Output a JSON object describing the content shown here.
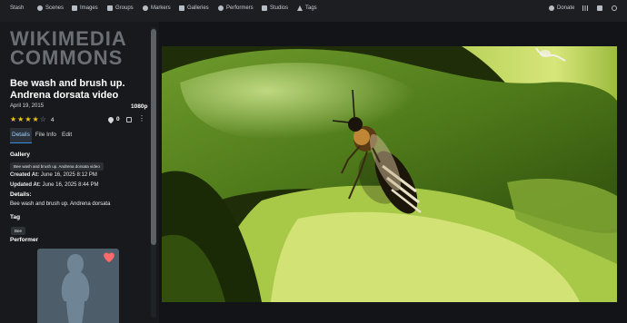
{
  "navbar": {
    "brand": "Stash",
    "items": [
      {
        "label": "Scenes",
        "icon": "play-circle-icon"
      },
      {
        "label": "Images",
        "icon": "image-icon"
      },
      {
        "label": "Groups",
        "icon": "film-icon"
      },
      {
        "label": "Markers",
        "icon": "location-marker-icon"
      },
      {
        "label": "Galleries",
        "icon": "gallery-icon"
      },
      {
        "label": "Performers",
        "icon": "user-icon"
      },
      {
        "label": "Studios",
        "icon": "video-camera-icon"
      },
      {
        "label": "Tags",
        "icon": "tag-icon"
      }
    ],
    "donate_label": "Donate",
    "right_icons": [
      "heart-icon",
      "stats-icon",
      "grid-icon",
      "settings-icon"
    ]
  },
  "scene": {
    "studio_logo_text": "WIKIMEDIA COMMONS",
    "title": "Bee wash and brush up. Andrena dorsata video",
    "date": "April 19, 2015",
    "resolution": "1080p",
    "rating": 4,
    "rating_label": "4",
    "o_counter": "0",
    "tabs": [
      {
        "label": "Details",
        "active": true
      },
      {
        "label": "File Info",
        "active": false
      },
      {
        "label": "Edit",
        "active": false
      }
    ],
    "gallery_label": "Gallery",
    "gallery_tooltip": "Bee wash and brush up. Andrena dorsata video",
    "created_label": "Created At:",
    "created_value": "June 16, 2025 8:12 PM",
    "updated_label": "Updated At:",
    "updated_value": "June 16, 2025 8:44 PM",
    "details_label": "Details:",
    "details_text": "Bee wash and brush up. Andrena dorsata",
    "tag_label": "Tag",
    "tags": [
      "Bee"
    ],
    "performer_label": "Performer"
  },
  "colors": {
    "background": "#121417",
    "navbar": "#1c1e22",
    "panel": "#17191c",
    "accent_blue": "#3b8fe0",
    "star_gold": "#f5c418",
    "heart_red": "#ff6b6b",
    "performer_bg": "#4e5d6a"
  }
}
